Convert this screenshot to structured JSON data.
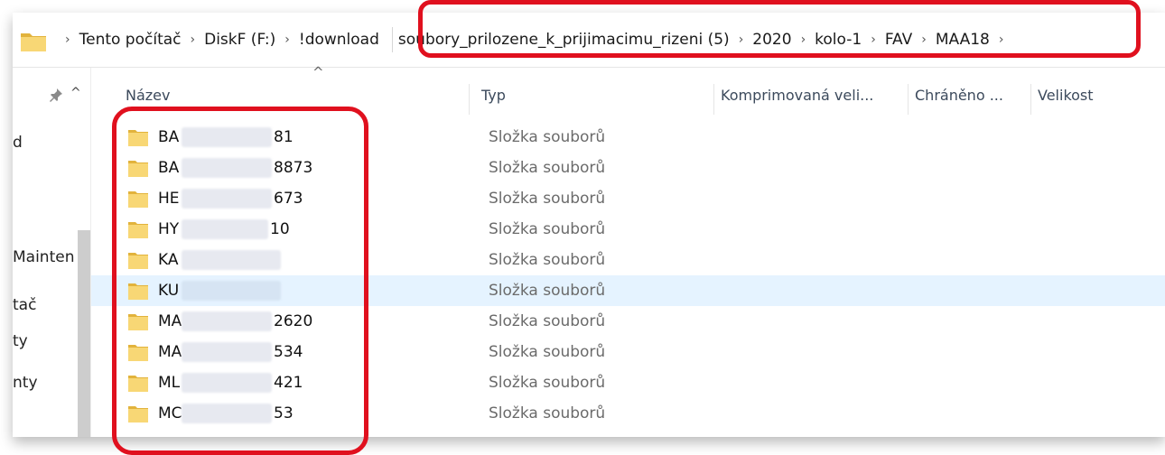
{
  "breadcrumb": {
    "segments": [
      "Tento počítač",
      "DiskF (F:)",
      "!download",
      "soubory_prilozene_k_prijimacimu_rizeni (5)",
      "2020",
      "kolo-1",
      "FAV",
      "MAA18"
    ]
  },
  "nav": {
    "items": [
      "d",
      "Mainten",
      "tač",
      "ty",
      "nty"
    ]
  },
  "columns": {
    "name": "Název",
    "type": "Typ",
    "compressed": "Komprimovaná veli...",
    "protected": "Chráněno ...",
    "size": "Velikost"
  },
  "files": [
    {
      "prefix": "BA",
      "suffix": "81",
      "type": "Složka souborů",
      "selected": false
    },
    {
      "prefix": "BA",
      "suffix": "8873",
      "type": "Složka souborů",
      "selected": false
    },
    {
      "prefix": "HE",
      "suffix": "673",
      "type": "Složka souborů",
      "selected": false
    },
    {
      "prefix": "HY",
      "suffix": "10",
      "type": "Složka souborů",
      "selected": false
    },
    {
      "prefix": "KA",
      "suffix": "",
      "type": "Složka souborů",
      "selected": false
    },
    {
      "prefix": "KU",
      "suffix": "",
      "type": "Složka souborů",
      "selected": true
    },
    {
      "prefix": "MA",
      "suffix": "2620",
      "type": "Složka souborů",
      "selected": false
    },
    {
      "prefix": "MA",
      "suffix": "534",
      "type": "Složka souborů",
      "selected": false
    },
    {
      "prefix": "ML",
      "suffix": "421",
      "type": "Složka souborů",
      "selected": false
    },
    {
      "prefix": "MC",
      "suffix": "53",
      "type": "Složka souborů",
      "selected": false
    }
  ],
  "colors": {
    "folder": "#f8d775",
    "folder_dark": "#e2b33c",
    "selection": "#e5f3ff",
    "highlight": "#e0101e"
  }
}
